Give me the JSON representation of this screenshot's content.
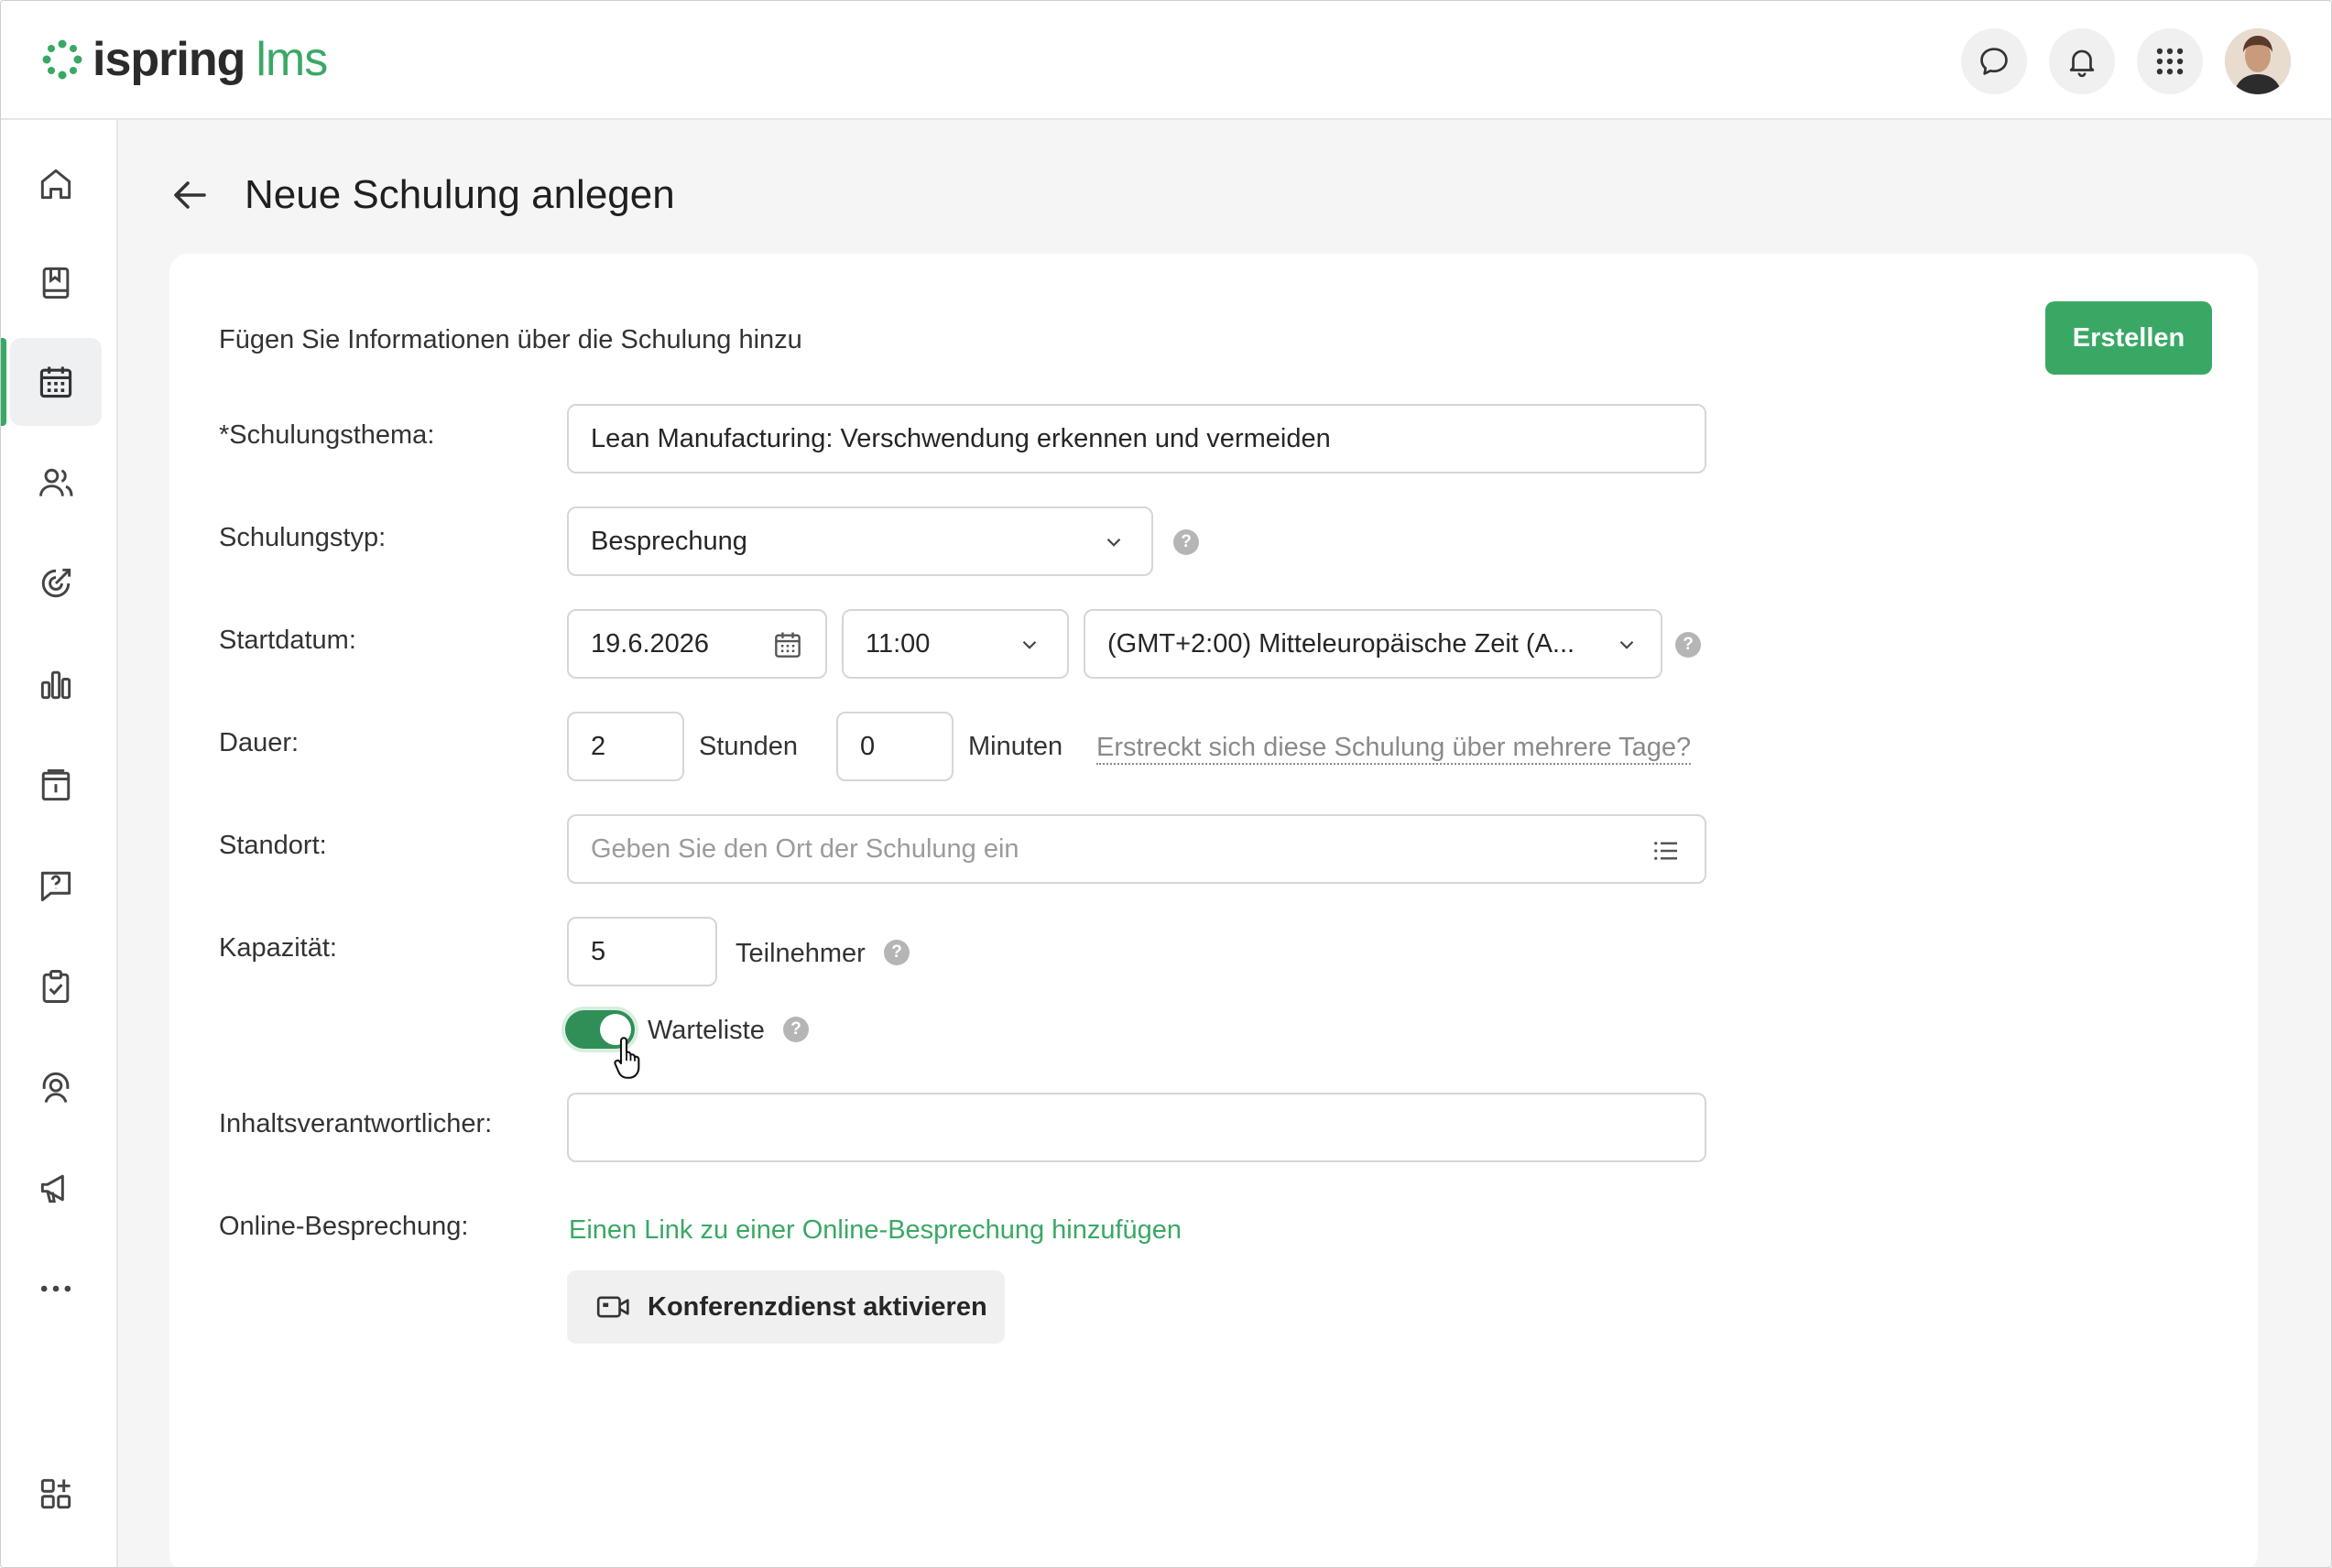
{
  "app": {
    "logo_word1": "ispring",
    "logo_word2": "lms"
  },
  "header": {
    "icons": [
      "chat-icon",
      "bell-icon",
      "apps-grid-icon",
      "user-avatar"
    ]
  },
  "sidebar": {
    "items": [
      {
        "name": "home-icon",
        "active": false
      },
      {
        "name": "book-icon",
        "active": false
      },
      {
        "name": "calendar-icon",
        "active": true
      },
      {
        "name": "users-icon",
        "active": false
      },
      {
        "name": "target-icon",
        "active": false
      },
      {
        "name": "bar-chart-icon",
        "active": false
      },
      {
        "name": "info-board-icon",
        "active": false
      },
      {
        "name": "question-chat-icon",
        "active": false
      },
      {
        "name": "clipboard-check-icon",
        "active": false
      },
      {
        "name": "support-agent-icon",
        "active": false
      },
      {
        "name": "megaphone-icon",
        "active": false
      },
      {
        "name": "more-dots-icon",
        "active": false
      },
      {
        "name": "add-widget-icon",
        "active": false
      }
    ]
  },
  "page": {
    "title": "Neue Schulung anlegen",
    "subtitle": "Fügen Sie Informationen über die Schulung hinzu",
    "create_button": "Erstellen"
  },
  "form": {
    "topic": {
      "label": "*Schulungsthema:",
      "value": "Lean Manufacturing: Verschwendung erkennen und vermeiden"
    },
    "type": {
      "label": "Schulungstyp:",
      "value": "Besprechung"
    },
    "start": {
      "label": "Startdatum:",
      "date": "19.6.2026",
      "time": "11:00",
      "timezone": "(GMT+2:00) Mitteleuropäische Zeit (A..."
    },
    "duration": {
      "label": "Dauer:",
      "hours": "2",
      "hours_unit": "Stunden",
      "minutes": "0",
      "minutes_unit": "Minuten",
      "multi_day_link": "Erstreckt sich diese Schulung über mehrere Tage?"
    },
    "location": {
      "label": "Standort:",
      "placeholder": "Geben Sie den Ort der Schulung ein"
    },
    "capacity": {
      "label": "Kapazität:",
      "value": "5",
      "unit": "Teilnehmer",
      "waitlist_label": "Warteliste",
      "waitlist_on": true
    },
    "owner": {
      "label": "Inhaltsverantwortlicher:",
      "value": ""
    },
    "online": {
      "label": "Online-Besprechung:",
      "add_link": "Einen Link zu einer Online-Besprechung hinzufügen",
      "conference_button": "Konferenzdienst aktivieren"
    }
  },
  "colors": {
    "accent": "#3aa865",
    "toggle": "#2f8f57"
  }
}
